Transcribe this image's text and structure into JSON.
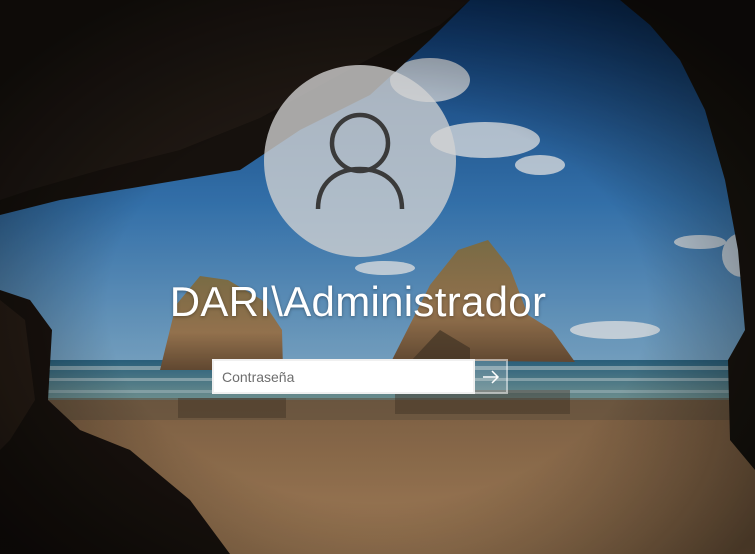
{
  "login": {
    "username": "DARI\\Administrador",
    "password": {
      "value": "",
      "placeholder": "Contraseña"
    },
    "submit_icon": "arrow-right-icon",
    "avatar_icon": "user-icon"
  },
  "colors": {
    "sky": "#2f6fb1",
    "sea": "#3f8eb0",
    "sand": "#a9815a",
    "avatar_bg": "#d2d2d2",
    "text": "#ffffff"
  }
}
